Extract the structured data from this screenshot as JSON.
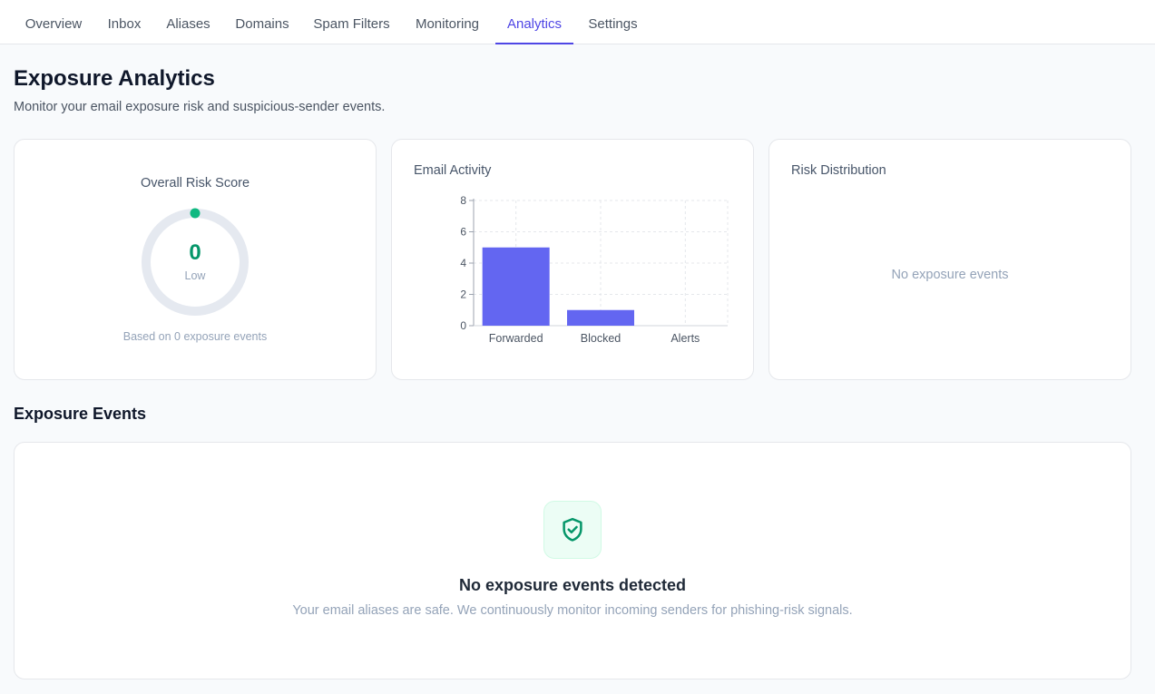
{
  "nav": {
    "tabs": [
      {
        "label": "Overview"
      },
      {
        "label": "Inbox"
      },
      {
        "label": "Aliases"
      },
      {
        "label": "Domains"
      },
      {
        "label": "Spam Filters"
      },
      {
        "label": "Monitoring"
      },
      {
        "label": "Analytics",
        "active": true
      },
      {
        "label": "Settings"
      }
    ]
  },
  "header": {
    "title": "Exposure Analytics",
    "subtitle": "Monitor your email exposure risk and suspicious-sender events."
  },
  "risk": {
    "title": "Overall Risk Score",
    "score": "0",
    "level": "Low",
    "footnote": "Based on 0 exposure events",
    "score_fraction": 0,
    "colors": {
      "track": "#e5e9f0",
      "indicator": "#10b981",
      "value": "#059669"
    }
  },
  "activity": {
    "title": "Email Activity"
  },
  "chart_data": {
    "type": "bar",
    "categories": [
      "Forwarded",
      "Blocked",
      "Alerts"
    ],
    "values": [
      5,
      1,
      0
    ],
    "ylim": [
      0,
      8
    ],
    "yticks": [
      0,
      2,
      4,
      6,
      8
    ],
    "grid": true,
    "bar_color": "#6366f1"
  },
  "distribution": {
    "title": "Risk Distribution",
    "empty_text": "No exposure events"
  },
  "events": {
    "title": "Exposure Events",
    "empty_title": "No exposure events detected",
    "empty_subtitle": "Your email aliases are safe. We continuously monitor incoming senders for phishing-risk signals.",
    "icon": "shield-check-icon"
  }
}
